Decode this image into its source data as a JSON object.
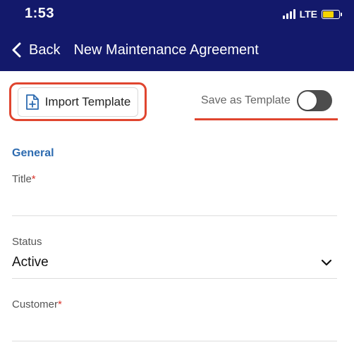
{
  "status_bar": {
    "time": "1:53",
    "network": "LTE",
    "battery_color": "#f5d400"
  },
  "nav": {
    "back_label": "Back",
    "title": "New Maintenance Agreement",
    "back_icon": "chevron-left-icon"
  },
  "toolbar": {
    "import_label": "Import Template",
    "import_icon": "file-plus-icon",
    "save_template_label": "Save as Template",
    "save_template_on": false
  },
  "form": {
    "section_title": "General",
    "fields": [
      {
        "label": "Title",
        "required_mark": "*",
        "value": ""
      },
      {
        "label": "Status",
        "required_mark": "",
        "value": "Active"
      },
      {
        "label": "Customer",
        "required_mark": "*",
        "value": ""
      }
    ]
  },
  "colors": {
    "header_bg": "#13196b",
    "accent": "#2d6bb0",
    "highlight": "#e0452f",
    "required": "#d9342b"
  }
}
